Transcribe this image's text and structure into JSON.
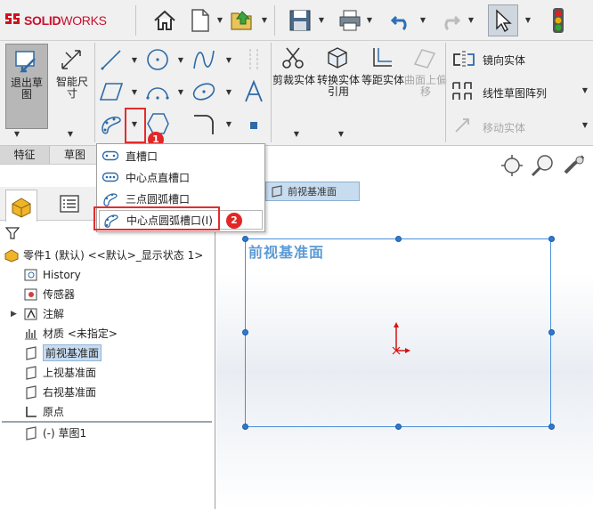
{
  "brand": {
    "ds_mark": "𝟑S",
    "name": "SOLID",
    "name_suffix": "WORKS"
  },
  "ribbon": {
    "exit_sketch": "退出草图",
    "smart_dimension": "智能尺寸",
    "trim": "剪裁实体",
    "convert": "转换实体引用",
    "offset": "等距实体",
    "surface_offset": "曲面上偏移",
    "mirror": "镜向实体",
    "linear_pattern": "线性草图阵列",
    "move": "移动实体"
  },
  "tabs": {
    "feature": "特征",
    "sketch": "草图"
  },
  "slot_menu": {
    "items": [
      {
        "label": "直槽口"
      },
      {
        "label": "中心点直槽口"
      },
      {
        "label": "三点圆弧槽口"
      },
      {
        "label": "中心点圆弧槽口(I)"
      }
    ]
  },
  "badges": {
    "one": "1",
    "two": "2"
  },
  "tree": {
    "part": "零件1 (默认) <<默认>_显示状态 1>",
    "items": [
      {
        "label": "History"
      },
      {
        "label": "传感器"
      },
      {
        "label": "注解"
      },
      {
        "label": "材质 <未指定>"
      },
      {
        "label": "前视基准面"
      },
      {
        "label": "上视基准面"
      },
      {
        "label": "右视基准面"
      },
      {
        "label": "原点"
      },
      {
        "label": "(-) 草图1"
      }
    ]
  },
  "graphics": {
    "plane_tooltip": "前视基准面",
    "plane_label": "前视基准面"
  },
  "colors": {
    "accent_red": "#e52b2b",
    "selection_blue": "#4a90d9"
  }
}
